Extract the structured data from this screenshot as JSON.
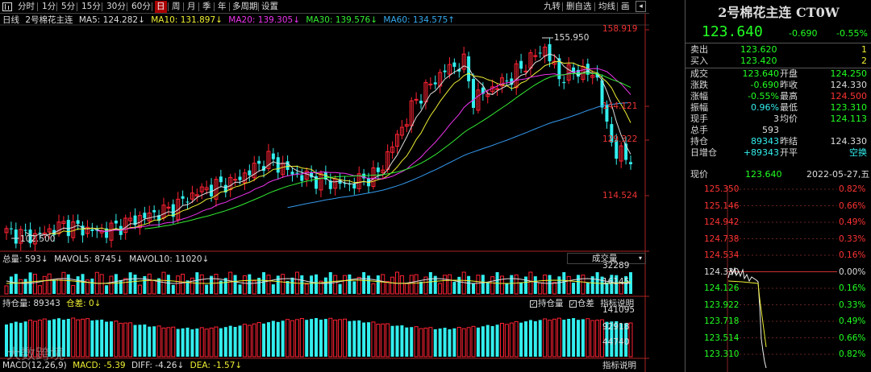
{
  "toolbar": {
    "periods": [
      "分时",
      "1分",
      "5分",
      "15分",
      "30分",
      "60分",
      "日",
      "周",
      "月",
      "季",
      "年",
      "多周期",
      "设置"
    ],
    "right_actions": [
      "九转",
      "删自选",
      "均线",
      "画"
    ],
    "active_period": "日"
  },
  "main_legend": {
    "period": "日线",
    "name": "2号棉花主连",
    "ma5": "MA5: 124.282↓",
    "ma10": "MA10: 131.897↓",
    "ma20": "MA20: 139.305↓",
    "ma30": "MA30: 139.576↓",
    "ma60": "MA60: 134.575↑"
  },
  "price_axis": [
    "158.919",
    "144.121",
    "129.322",
    "114.524"
  ],
  "annotations": {
    "high": "155.950",
    "low": "102.500"
  },
  "vol_legend": {
    "main": "总量: 593↓",
    "mavol5": "MAVOL5: 8745↓",
    "mavol10": "MAVOL10: 11020↓",
    "dropdown": "成交量"
  },
  "vol_axis": [
    "32289",
    "16145"
  ],
  "oi_legend": {
    "main": "持仓量: 89343",
    "diff": "仓差: 0↓",
    "check1": "持仓量",
    "check2": "仓差",
    "explain": "指标说明"
  },
  "oi_axis": [
    "141095",
    "92918",
    "44740"
  ],
  "macd_legend": {
    "main": "MACD(12,26,9)",
    "macd": "MACD: -5.39",
    "diff": "DIFF: -4.26↓",
    "dea": "DEA: -1.57↓",
    "explain": "指标说明"
  },
  "watermark": "大数跨境",
  "panel": {
    "title": "2号棉花主连 CT0W",
    "price": "123.640",
    "change": "-0.690",
    "change_pct": "-0.55%",
    "sell_label": "卖出",
    "sell_price": "123.620",
    "sell_vol": "1",
    "buy_label": "买入",
    "buy_price": "123.420",
    "buy_vol": "2",
    "rows": [
      {
        "l1": "成交",
        "v1": "123.640",
        "c1": "g",
        "l2": "开盘",
        "v2": "124.250",
        "c2": "g"
      },
      {
        "l1": "涨跌",
        "v1": "-0.690",
        "c1": "g",
        "l2": "昨收",
        "v2": "124.330",
        "c2": "w"
      },
      {
        "l1": "涨幅",
        "v1": "-0.55%",
        "c1": "g",
        "l2": "最高",
        "v2": "124.500",
        "c2": "r"
      },
      {
        "l1": "振幅",
        "v1": "0.96%",
        "c1": "c",
        "l2": "最低",
        "v2": "123.310",
        "c2": "g"
      },
      {
        "l1": "现手",
        "v1": "3",
        "c1": "w",
        "l2": "均价",
        "v2": "124.113",
        "c2": "g"
      },
      {
        "l1": "总手",
        "v1": "593",
        "c1": "w",
        "l2": "",
        "v2": "",
        "c2": "w"
      },
      {
        "l1": "持仓",
        "v1": "89343",
        "c1": "c",
        "l2": "昨结",
        "v2": "124.330",
        "c2": "w"
      },
      {
        "l1": "日增仓",
        "v1": "+89343",
        "c1": "c",
        "l2": "开平",
        "v2": "空换",
        "c2": "c"
      }
    ],
    "mini_head_label": "现价",
    "mini_head_price": "123.640",
    "mini_head_date": "2022-05-27,五",
    "mini_left": [
      "125.350",
      "125.146",
      "124.942",
      "124.738",
      "124.534",
      "124.330",
      "124.126",
      "123.922",
      "123.718",
      "123.514",
      "123.310"
    ],
    "mini_right": [
      "0.82%",
      "0.66%",
      "0.49%",
      "0.33%",
      "0.16%",
      "0.00%",
      "0.16%",
      "0.33%",
      "0.49%",
      "0.66%",
      "0.82%"
    ]
  },
  "colors": {
    "up": "#f23",
    "down": "#3ee",
    "ma5": "#ddd",
    "ma10": "#ee3",
    "ma20": "#e3e",
    "ma30": "#3e3",
    "ma60": "#39e"
  }
}
